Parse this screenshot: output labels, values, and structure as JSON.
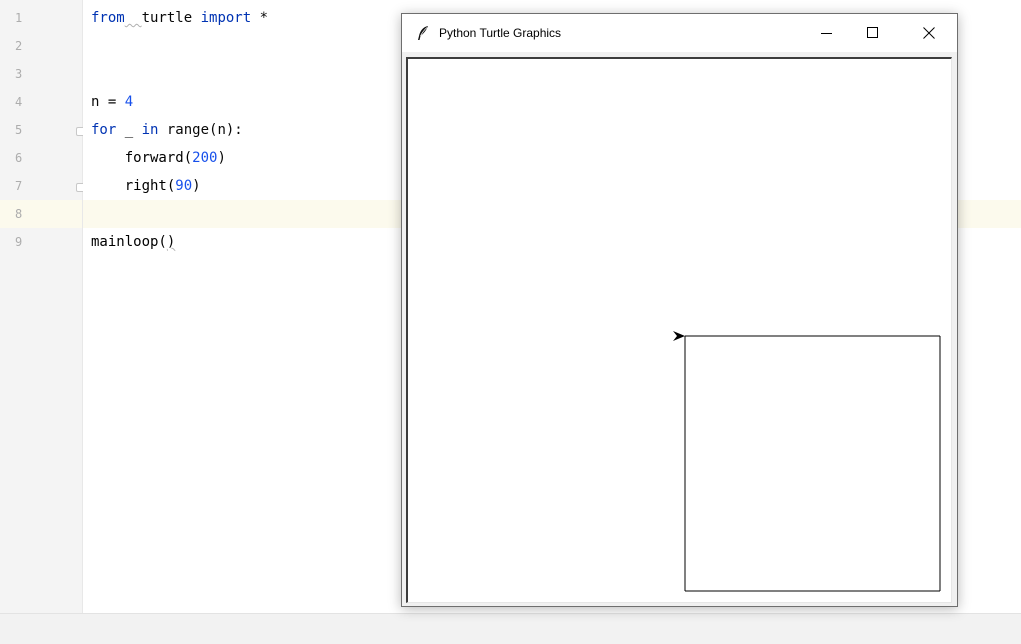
{
  "editor": {
    "line_numbers": [
      "1",
      "2",
      "3",
      "4",
      "5",
      "6",
      "7",
      "8",
      "9"
    ],
    "current_line": 8,
    "code": {
      "line1": {
        "kw_from": "from",
        "module": "turtle",
        "kw_import": "import",
        "star": "*"
      },
      "line4": {
        "var": "n",
        "op": " = ",
        "value": "4"
      },
      "line5": {
        "kw_for": "for",
        "rest_a": " _ ",
        "kw_in": "in",
        "rest_b": " range(n):"
      },
      "line6": {
        "call": "forward(",
        "arg": "200",
        "close": ")"
      },
      "line7": {
        "call": "right(",
        "arg": "90",
        "close": ")"
      },
      "line9": {
        "call": "mainloop(",
        "close": ")"
      }
    },
    "colors": {
      "keyword": "#0033b3",
      "number": "#1750eb",
      "current_line_bg": "#fcfaed"
    }
  },
  "turtle_window": {
    "title": "Python Turtle Graphics",
    "icon": "feather-icon",
    "controls": [
      "minimize-icon",
      "maximize-icon",
      "close-icon"
    ],
    "drawing": {
      "shape": "square",
      "sides": 4,
      "side_length": 200,
      "turn_angle": 90,
      "turtle_heading": "east",
      "turtle_at": "start-corner"
    }
  }
}
